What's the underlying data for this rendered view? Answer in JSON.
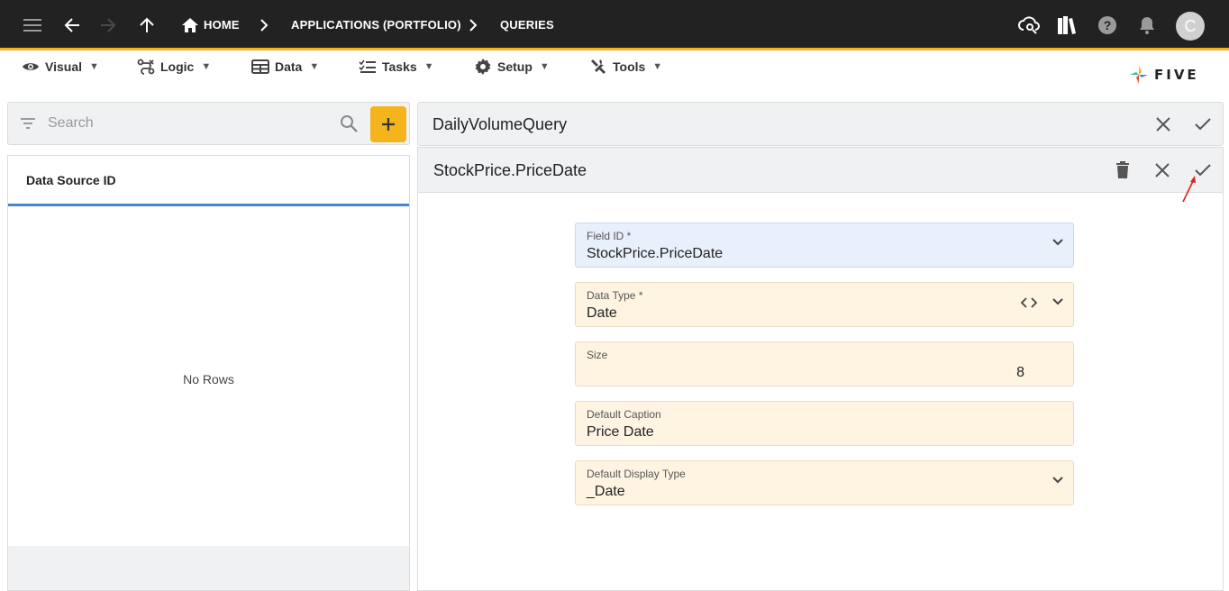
{
  "topbar": {
    "breadcrumbs": [
      "HOME",
      "APPLICATIONS (PORTFOLIO)",
      "QUERIES"
    ],
    "avatar_letter": "C",
    "icons": [
      "menu-icon",
      "back-arrow-icon",
      "forward-arrow-icon",
      "up-arrow-icon",
      "home-icon",
      "cloud-settings-icon",
      "library-icon",
      "help-icon",
      "bell-icon"
    ]
  },
  "menubar": {
    "items": [
      {
        "label": "Visual",
        "icon": "eye-icon"
      },
      {
        "label": "Logic",
        "icon": "logic-icon"
      },
      {
        "label": "Data",
        "icon": "table-icon"
      },
      {
        "label": "Tasks",
        "icon": "tasks-icon"
      },
      {
        "label": "Setup",
        "icon": "gear-icon"
      },
      {
        "label": "Tools",
        "icon": "tools-icon"
      }
    ],
    "caret": "▼",
    "logo_text": "FIVE"
  },
  "left": {
    "search_placeholder": "Search",
    "column_header": "Data Source ID",
    "empty_text": "No Rows"
  },
  "query": {
    "title": "DailyVolumeQuery"
  },
  "field": {
    "title": "StockPrice.PriceDate",
    "fields": [
      {
        "label": "Field ID *",
        "value": "StockPrice.PriceDate"
      },
      {
        "label": "Data Type *",
        "value": "Date"
      },
      {
        "label": "Size",
        "value": "8"
      },
      {
        "label": "Default Caption",
        "value": "Price Date"
      },
      {
        "label": "Default Display Type",
        "value": "_Date"
      }
    ]
  },
  "colors": {
    "topbar": "#222222",
    "accent": "#f5b31c",
    "header_underline": "#4a86cf",
    "field_blue": "#e7f0fb",
    "field_cream": "#fff4e2",
    "annotation_arrow": "#e02020"
  }
}
